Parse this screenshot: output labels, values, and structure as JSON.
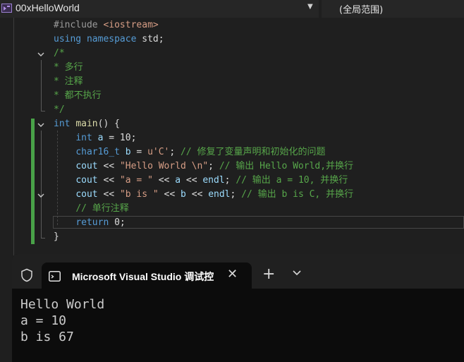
{
  "navbar": {
    "project_name": "00xHelloWorld",
    "scope_label": "(全局范围)"
  },
  "editor": {
    "lines": [
      [
        {
          "t": "#include ",
          "c": "pre"
        },
        {
          "t": "<iostream>",
          "c": "str"
        }
      ],
      [
        {
          "t": "using",
          "c": "kw"
        },
        {
          "t": " ",
          "c": "pl"
        },
        {
          "t": "namespace",
          "c": "kw"
        },
        {
          "t": " std;",
          "c": "pl"
        }
      ],
      [
        {
          "t": "/*",
          "c": "cm"
        }
      ],
      [
        {
          "t": "* 多行",
          "c": "cm"
        }
      ],
      [
        {
          "t": "* 注释",
          "c": "cm"
        }
      ],
      [
        {
          "t": "* 都不执行",
          "c": "cm"
        }
      ],
      [
        {
          "t": "*/",
          "c": "cm"
        }
      ],
      [
        {
          "t": "int",
          "c": "kw"
        },
        {
          "t": " ",
          "c": "pl"
        },
        {
          "t": "main",
          "c": "fn"
        },
        {
          "t": "() {",
          "c": "pl"
        }
      ],
      [
        {
          "t": "    ",
          "c": "pl"
        },
        {
          "t": "int",
          "c": "kw"
        },
        {
          "t": " ",
          "c": "pl"
        },
        {
          "t": "a",
          "c": "id"
        },
        {
          "t": " = 10;",
          "c": "pl"
        }
      ],
      [
        {
          "t": "    ",
          "c": "pl"
        },
        {
          "t": "char16_t",
          "c": "kw"
        },
        {
          "t": " ",
          "c": "pl"
        },
        {
          "t": "b",
          "c": "id"
        },
        {
          "t": " = ",
          "c": "pl"
        },
        {
          "t": "u'C'",
          "c": "str"
        },
        {
          "t": "; ",
          "c": "pl"
        },
        {
          "t": "// 修复了变量声明和初始化的问题",
          "c": "cm"
        }
      ],
      [
        {
          "t": "    ",
          "c": "pl"
        },
        {
          "t": "cout",
          "c": "id"
        },
        {
          "t": " << ",
          "c": "pl"
        },
        {
          "t": "\"Hello World \\n\"",
          "c": "str"
        },
        {
          "t": "; ",
          "c": "pl"
        },
        {
          "t": "// 输出 Hello World,并换行",
          "c": "cm"
        }
      ],
      [
        {
          "t": "    ",
          "c": "pl"
        },
        {
          "t": "cout",
          "c": "id"
        },
        {
          "t": " << ",
          "c": "pl"
        },
        {
          "t": "\"a = \"",
          "c": "str"
        },
        {
          "t": " << ",
          "c": "pl"
        },
        {
          "t": "a",
          "c": "id"
        },
        {
          "t": " << ",
          "c": "pl"
        },
        {
          "t": "endl",
          "c": "id"
        },
        {
          "t": "; ",
          "c": "pl"
        },
        {
          "t": "// 输出 a = 10, 并换行",
          "c": "cm"
        }
      ],
      [
        {
          "t": "    ",
          "c": "pl"
        },
        {
          "t": "cout",
          "c": "id"
        },
        {
          "t": " << ",
          "c": "pl"
        },
        {
          "t": "\"b is \"",
          "c": "str"
        },
        {
          "t": " << ",
          "c": "pl"
        },
        {
          "t": "b",
          "c": "id"
        },
        {
          "t": " << ",
          "c": "pl"
        },
        {
          "t": "endl",
          "c": "id"
        },
        {
          "t": "; ",
          "c": "pl"
        },
        {
          "t": "// 输出 b is C, 并换行",
          "c": "cm"
        }
      ],
      [
        {
          "t": "    ",
          "c": "pl"
        },
        {
          "t": "// 单行注释",
          "c": "cm"
        }
      ],
      [
        {
          "t": "    ",
          "c": "pl"
        },
        {
          "t": "return",
          "c": "kw"
        },
        {
          "t": " 0;",
          "c": "pl"
        }
      ],
      [
        {
          "t": "}",
          "c": "pl"
        }
      ]
    ]
  },
  "console": {
    "tab_title": "Microsoft Visual Studio 调试控",
    "output": [
      "Hello World",
      "a = 10",
      "b is 67"
    ]
  },
  "icons": {
    "project": "vs-project-icon",
    "dropdown": "chevron-down-icon",
    "shield": "shield-icon",
    "terminal": "terminal-icon",
    "close": "close-icon",
    "new_tab": "plus-icon",
    "tab_dropdown": "chevron-down-icon"
  }
}
